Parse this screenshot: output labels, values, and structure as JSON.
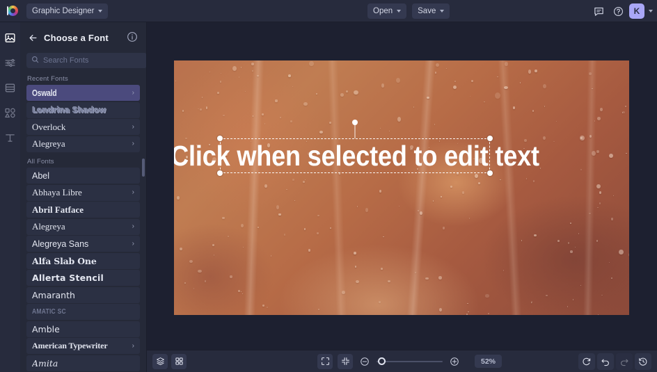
{
  "app": {
    "name": "graphic-designer-editor",
    "brand_icon": "palette-logo",
    "document_name": "Graphic Designer",
    "accent": "#4b4a7d",
    "avatar_bg": "#a9a7f7",
    "highlight_box_color": "#e03a1f",
    "canvas_base_color": "#b76c47"
  },
  "topbar": {
    "open_label": "Open",
    "save_label": "Save",
    "comment_icon": "comment-icon",
    "help_icon": "help-circle-icon",
    "avatar_initial": "K"
  },
  "rail": {
    "items": [
      {
        "icon": "image-icon",
        "name": "sidebar-item-image",
        "active": true
      },
      {
        "icon": "adjustments-icon",
        "name": "sidebar-item-adjust",
        "active": false
      },
      {
        "icon": "layout-icon",
        "name": "sidebar-item-layout",
        "active": false
      },
      {
        "icon": "shapes-icon",
        "name": "sidebar-item-shapes",
        "active": false
      },
      {
        "icon": "text-icon",
        "name": "sidebar-item-text",
        "active": false
      }
    ]
  },
  "panel": {
    "back_icon": "arrow-left-icon",
    "title": "Choose a Font",
    "info_icon": "info-circle-icon",
    "search_placeholder": "Search Fonts",
    "search_value": "",
    "search_icon": "search-icon",
    "favorite_icon": "star-icon",
    "add_icon": "plus-icon",
    "recent_label": "Recent Fonts",
    "all_label": "All Fonts",
    "recent_fonts": [
      {
        "name": "Oswald",
        "style": "f-oswald",
        "selected": true,
        "chevron": true
      },
      {
        "name": "Londrina Shadow",
        "style": "f-shadow",
        "selected": false,
        "chevron": false
      },
      {
        "name": "Overlock",
        "style": "f-serif",
        "selected": false,
        "chevron": true
      },
      {
        "name": "Alegreya",
        "style": "f-serif",
        "selected": false,
        "chevron": true
      }
    ],
    "all_fonts": [
      {
        "name": "Abel",
        "style": "f-sans",
        "selected": false,
        "chevron": false
      },
      {
        "name": "Abhaya Libre",
        "style": "f-serif",
        "selected": false,
        "chevron": true
      },
      {
        "name": "Abril Fatface",
        "style": "f-serif-b",
        "selected": false,
        "chevron": false
      },
      {
        "name": "Alegreya",
        "style": "f-serif",
        "selected": false,
        "chevron": true
      },
      {
        "name": "Alegreya Sans",
        "style": "f-sans",
        "selected": false,
        "chevron": true
      },
      {
        "name": "Alfa Slab One",
        "style": "f-slab",
        "selected": false,
        "chevron": false
      },
      {
        "name": "Allerta Stencil",
        "style": "f-stencil",
        "selected": false,
        "chevron": false
      },
      {
        "name": "Amaranth",
        "style": "f-round",
        "selected": false,
        "chevron": false
      },
      {
        "name": "Amatic SC",
        "style": "f-caps",
        "selected": false,
        "chevron": false
      },
      {
        "name": "Amble",
        "style": "f-round",
        "selected": false,
        "chevron": false
      },
      {
        "name": "American Typewriter",
        "style": "f-mono",
        "selected": false,
        "chevron": true
      },
      {
        "name": "Amita",
        "style": "f-script",
        "selected": false,
        "chevron": false
      }
    ]
  },
  "canvas": {
    "text_object": "Click when selected to edit text",
    "selection_handles": [
      "top-left",
      "top-right",
      "bottom-left",
      "bottom-right",
      "rotate"
    ]
  },
  "bottombar": {
    "layers_icon": "layers-icon",
    "grid_icon": "grid-icon",
    "fit_icon": "fit-to-screen-icon",
    "shrink_icon": "shrink-icon",
    "zoom_out_icon": "zoom-out-icon",
    "zoom_in_icon": "zoom-in-icon",
    "zoom_value": "52%",
    "reset_icon": "reset-icon",
    "undo_icon": "undo-icon",
    "redo_icon": "redo-icon",
    "history_icon": "history-icon"
  }
}
